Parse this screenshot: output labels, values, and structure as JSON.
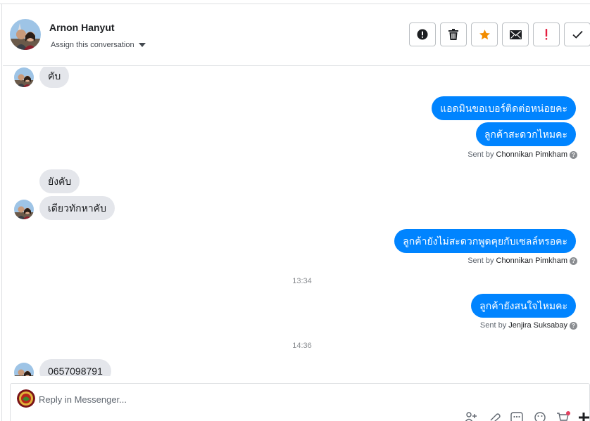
{
  "header": {
    "contact_name": "Arnon Hanyut",
    "assign_label": "Assign this conversation",
    "actions": [
      {
        "name": "spam-button",
        "icon": "alert-circle-icon"
      },
      {
        "name": "delete-button",
        "icon": "trash-icon"
      },
      {
        "name": "star-button",
        "icon": "star-icon",
        "color": "#f28c00"
      },
      {
        "name": "mark-unread-button",
        "icon": "envelope-icon"
      },
      {
        "name": "follow-up-button",
        "icon": "exclamation-icon",
        "color": "#e41e3f"
      },
      {
        "name": "mark-done-button",
        "icon": "check-icon"
      }
    ]
  },
  "thread": {
    "msg1": "คับ",
    "msg2": "แอดมินขอเบอร์ติดต่อหน่อยคะ",
    "msg3": "ลูกค้าสะดวกไหมคะ",
    "sent1_prefix": "Sent by",
    "sent1_name": "Chonnikan Pimkham",
    "msg4": "ยังคับ",
    "msg5": "เดียวทักหาคับ",
    "msg6": "ลูกค้ายังไม่สะดวกพูดคุยกับเซลล์หรอคะ",
    "sent2_prefix": "Sent by",
    "sent2_name": "Chonnikan Pimkham",
    "time1": "13:34",
    "msg7": "ลูกค้ายังสนใจไหมคะ",
    "sent3_prefix": "Sent by",
    "sent3_name": "Jenjira Suksabay",
    "time2": "14:36",
    "msg8": "0657098791"
  },
  "composer": {
    "placeholder": "Reply in Messenger..."
  },
  "colors": {
    "outgoing_bubble": "#0084ff",
    "incoming_bubble": "#e4e6eb"
  }
}
